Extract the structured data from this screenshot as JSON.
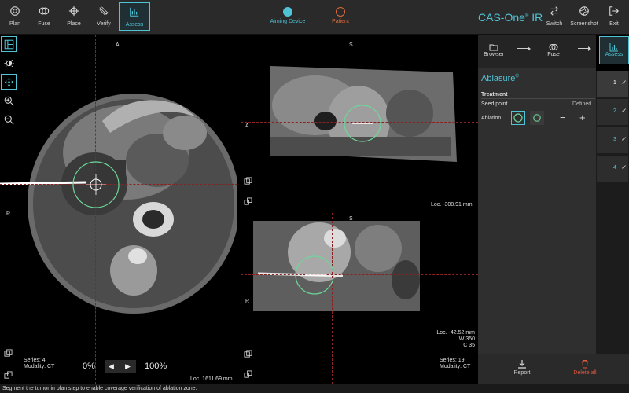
{
  "toolbar": {
    "tools": [
      {
        "label": "Plan"
      },
      {
        "label": "Fuse"
      },
      {
        "label": "Place"
      },
      {
        "label": "Verify"
      },
      {
        "label": "Assess"
      }
    ],
    "devices": [
      {
        "label": "Aiming Device",
        "color": "#4fc4d6"
      },
      {
        "label": "Patient",
        "color": "#e06a3a"
      }
    ],
    "brand": "CAS-One",
    "brand_mark": "®",
    "brand_suffix": " IR",
    "right": [
      {
        "label": "Switch"
      },
      {
        "label": "Screenshot"
      },
      {
        "label": "Exit"
      }
    ]
  },
  "views": {
    "axial": {
      "top_label": "A",
      "left_label": "R",
      "series": "Series: 4",
      "modality": "Modality: CT",
      "loc": "Loc. 1611.69 mm",
      "opacity_min": "0%",
      "opacity_max": "100%"
    },
    "sagittal": {
      "top_label": "S",
      "left_label": "A",
      "loc": "Loc. -308.91 mm"
    },
    "coronal": {
      "top_label": "S",
      "left_label": "R",
      "loc": "Loc. -42.52 mm",
      "window": "W 350",
      "center": "C 35",
      "series": "Series: 19",
      "modality": "Modality: CT"
    }
  },
  "panel": {
    "steps": [
      {
        "label": "Browser"
      },
      {
        "label": "Fuse"
      },
      {
        "label": "Assess"
      }
    ],
    "plugin_title": "Ablasure",
    "plugin_mark": "®",
    "section": "Treatment",
    "seed_label": "Seed point",
    "seed_status": "Defined",
    "ablation_label": "Ablation",
    "slots": [
      "1",
      "2",
      "3",
      "4"
    ],
    "report_label": "Report",
    "delete_label": "Delete all"
  },
  "status": "Segment the tumor in plan step to enable coverage verification of ablation zone.",
  "colors": {
    "accent": "#4fc4d6",
    "patient": "#e06a3a",
    "delete": "#e2583e",
    "ablation_zone": "#6fd69a"
  }
}
